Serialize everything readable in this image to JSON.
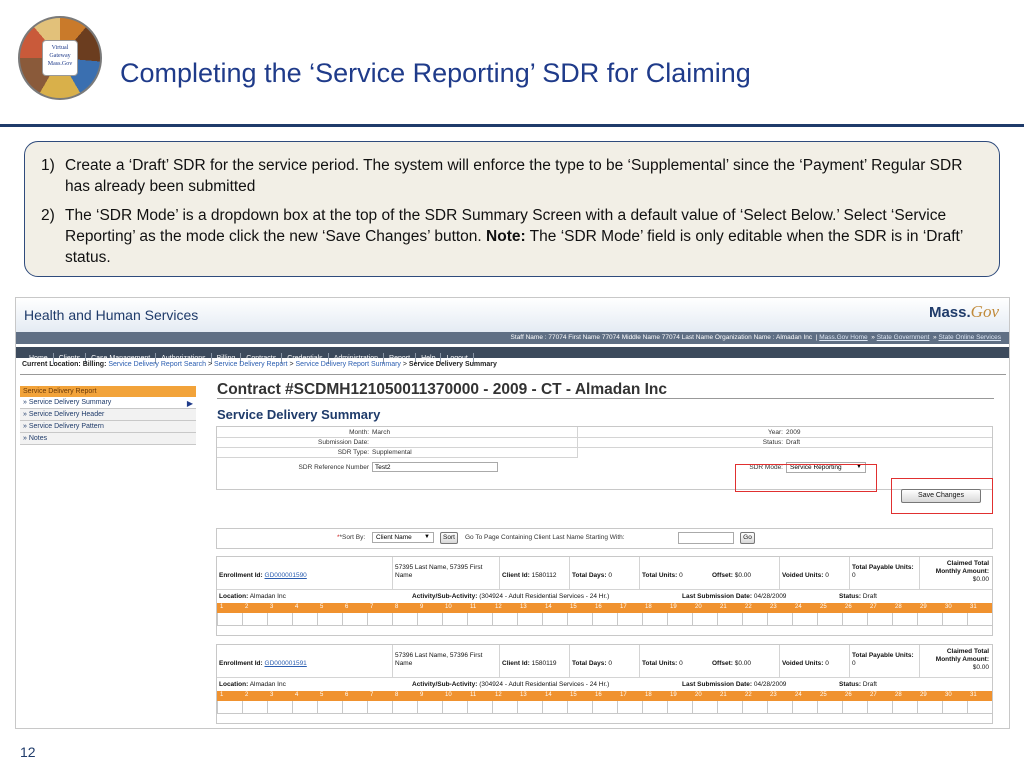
{
  "slide": {
    "title": "Completing the ‘Service Reporting’ SDR for Claiming",
    "page_number": "12",
    "logo_text": "Virtual Gateway Mass.Gov",
    "notes": [
      {
        "num": "1)",
        "text": "Create a ‘Draft’ SDR for the service period.  The system will enforce the type to be ‘Supplemental’ since the ‘Payment’ Regular SDR has already been submitted"
      },
      {
        "num": "2)",
        "text_before": "The ‘SDR Mode’ is a dropdown box at the top of the SDR Summary Screen with a default value of ‘Select Below.’  Select ‘Service Reporting’ as the mode click the new ‘Save Changes’ button.  ",
        "bold": "Note:",
        "text_after": " The ‘SDR Mode’ field is only editable when the SDR is in ‘Draft’ status."
      }
    ]
  },
  "app": {
    "header_title": "Health and Human Services",
    "brand": "Mass.",
    "brand_italic": "Gov",
    "staff_text": "Staff Name : 77074 First Name 77074 Middle Name 77074 Last Name Organization Name : Almadan Inc",
    "staff_links": [
      "Mass.Gov Home",
      "State Government",
      "State Online Services"
    ],
    "nav": [
      "Home",
      "Clients",
      "Case Management",
      "Authorizations",
      "Billing",
      "Contracts",
      "Credentials",
      "Administration",
      "Report",
      "Help",
      "Logout"
    ],
    "location_label": "Current Location:",
    "location_prefix": "Billing:",
    "breadcrumb": [
      "Service Delivery Report Search",
      "Service Delivery Report",
      "Service Delivery Report Summary"
    ],
    "breadcrumb_current": "Service Delivery Summary",
    "sidebar": {
      "header": "Service Delivery Report",
      "items": [
        "» Service Delivery Summary",
        "» Service Delivery Header",
        "» Service Delivery Pattern",
        "» Notes"
      ]
    },
    "contract_title": "Contract #SCDMH121050011370000 - 2009 - CT - Almadan Inc",
    "section_title": "Service Delivery Summary",
    "summary": {
      "month_label": "Month:",
      "month": "March",
      "year_label": "Year:",
      "year": "2009",
      "submission_label": "Submission Date:",
      "submission": "",
      "status_label": "Status:",
      "status": "Draft",
      "sdr_type_label": "SDR Type:",
      "sdr_type": "Supplemental",
      "sdr_ref_label": "SDR Reference Number",
      "sdr_ref": "Test2",
      "sdr_mode_label": "SDR Mode:",
      "sdr_mode": "Service Reporting"
    },
    "save_button": "Save Changes",
    "sort": {
      "label": "*Sort By:",
      "selected": "Client Name",
      "sort_btn": "Sort",
      "goto_label": "Go To Page Containing Client Last Name Starting With:",
      "goto_value": "",
      "go_btn": "Go"
    },
    "days": [
      "1",
      "2",
      "3",
      "4",
      "5",
      "6",
      "7",
      "8",
      "9",
      "10",
      "11",
      "12",
      "13",
      "14",
      "15",
      "16",
      "17",
      "18",
      "19",
      "20",
      "21",
      "22",
      "23",
      "24",
      "25",
      "26",
      "27",
      "28",
      "29",
      "30",
      "31"
    ],
    "enrollments": [
      {
        "enrollment_label": "Enrollment Id:",
        "enrollment_id": "GD000001590",
        "name": "57395 Last Name, 57395 First Name",
        "client_label": "Client Id:",
        "client_id": "1580112",
        "days_label": "Total Days:",
        "days": "0",
        "units_label": "Total Units:",
        "units": "0",
        "offset_label": "Offset:",
        "offset": "$0.00",
        "voided_label": "Voided Units:",
        "voided": "0",
        "payable_label": "Total Payable Units:",
        "payable": "0",
        "claimed_label": "Claimed Total Monthly Amount:",
        "claimed": "$0.00",
        "location_label": "Location:",
        "location": "Almadan Inc",
        "activity_label": "Activity/Sub-Activity:",
        "activity": "(304924 - Adult Residential Services - 24 Hr.)",
        "last_sub_label": "Last Submission Date:",
        "last_sub": "04/28/2009",
        "status_label": "Status:",
        "status": "Draft"
      },
      {
        "enrollment_label": "Enrollment Id:",
        "enrollment_id": "GD000001591",
        "name": "57396 Last Name, 57396 First Name",
        "client_label": "Client Id:",
        "client_id": "1580119",
        "days_label": "Total Days:",
        "days": "0",
        "units_label": "Total Units:",
        "units": "0",
        "offset_label": "Offset:",
        "offset": "$0.00",
        "voided_label": "Voided Units:",
        "voided": "0",
        "payable_label": "Total Payable Units:",
        "payable": "0",
        "claimed_label": "Claimed Total Monthly Amount:",
        "claimed": "$0.00",
        "location_label": "Location:",
        "location": "Almadan Inc",
        "activity_label": "Activity/Sub-Activity:",
        "activity": "(304924 - Adult Residential Services - 24 Hr.)",
        "last_sub_label": "Last Submission Date:",
        "last_sub": "04/28/2009",
        "status_label": "Status:",
        "status": "Draft"
      }
    ]
  }
}
